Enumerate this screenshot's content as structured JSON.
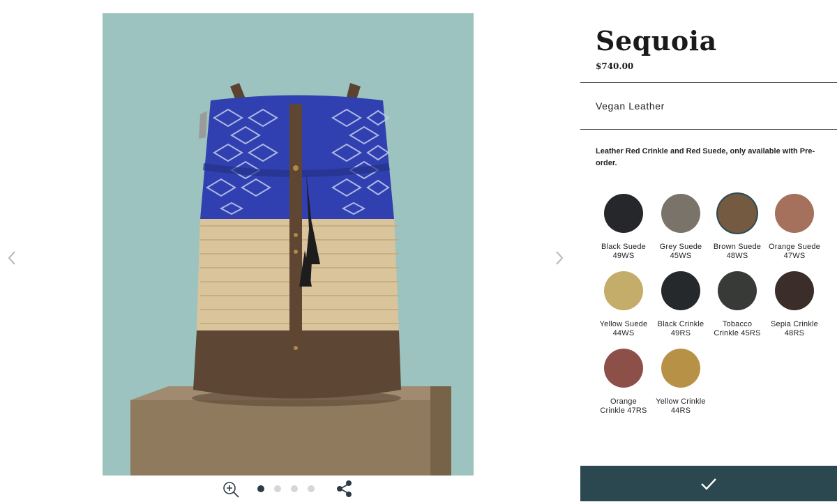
{
  "product": {
    "name": "Sequoia",
    "price": "$740.00",
    "material": "Vegan Leather",
    "note": "Leather Red Crinkle and Red Suede, only available with Pre-order."
  },
  "gallery": {
    "prev_icon": "chevron-left-icon",
    "next_icon": "chevron-right-icon",
    "zoom_icon": "zoom-in-icon",
    "share_icon": "share-icon",
    "image_alt": "Sequoia backpack",
    "slide_count": 4,
    "active_slide": 1
  },
  "swatches": [
    {
      "line1": "Black Suede",
      "line2": "49WS",
      "color": "#25272a"
    },
    {
      "line1": "Grey Suede",
      "line2": "45WS",
      "color": "#7a736a"
    },
    {
      "line1": "Brown Suede",
      "line2": "48WS",
      "color": "#735a40",
      "selected": true
    },
    {
      "line1": "Orange Suede",
      "line2": "47WS",
      "color": "#a5705c"
    },
    {
      "line1": "Yellow Suede",
      "line2": "44WS",
      "color": "#c4ac6b"
    },
    {
      "line1": "Black Crinkle",
      "line2": "49RS",
      "color": "#26292c"
    },
    {
      "line1": "Tobacco",
      "line2": "Crinkle 45RS",
      "color": "#373a36"
    },
    {
      "line1": "Sepia Crinkle",
      "line2": "48RS",
      "color": "#3a2d2a"
    },
    {
      "line1": "Orange",
      "line2": "Crinkle 47RS",
      "color": "#8d5048"
    },
    {
      "line1": "Yellow Crinkle",
      "line2": "44RS",
      "color": "#b79246"
    }
  ],
  "confirm": {
    "icon": "checkmark-icon"
  },
  "colors": {
    "accent": "#2b4750",
    "photo_bg": "#9cc3bf",
    "dot_active": "#2b3c44",
    "dot_inactive": "#d6d6d6"
  }
}
